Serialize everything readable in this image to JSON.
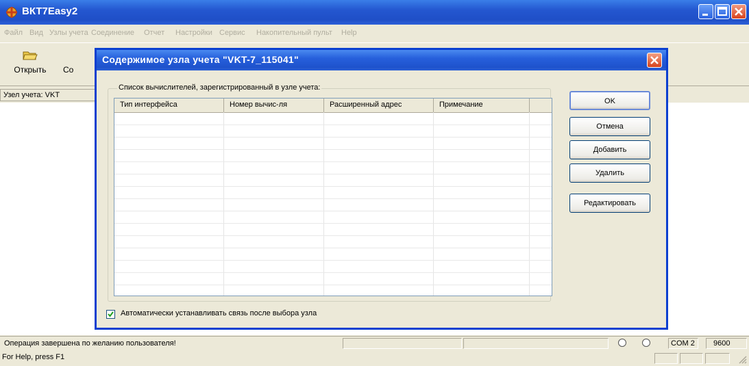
{
  "window": {
    "title": "ВКТ7Easy2"
  },
  "menu": [
    "Файл",
    "Вид",
    "Узлы учета",
    "Соединение",
    "Отчет",
    "Настройки",
    "Сервис",
    "Накопительный пульт",
    "Help"
  ],
  "toolbar": {
    "open_label": "Открыть",
    "second_label": "Со"
  },
  "node_bar": {
    "label": "Узел учета: VKT"
  },
  "dialog": {
    "title": "Содержимое узла учета \"VKT-7_115041\"",
    "group_label": "Список вычислителей, зарегистрированный в узле учета:",
    "columns": [
      "Тип интерфейса",
      "Номер вычис-ля",
      "Расширенный адрес",
      "Примечание"
    ],
    "buttons": {
      "ok": "OK",
      "cancel": "Отмена",
      "add": "Добавить",
      "delete": "Удалить",
      "edit": "Редактировать"
    },
    "checkbox_label": "Автоматически устанавливать связь после выбора узла",
    "checkbox_checked": true
  },
  "status": {
    "message": "Операция завершена по желанию пользователя!",
    "port": "COM 2",
    "baud": "9600",
    "help": "For Help, press F1"
  },
  "colors": {
    "title_bar": "#2457d0",
    "dialog_border": "#0a3fd0",
    "close_button": "#d6431c"
  }
}
